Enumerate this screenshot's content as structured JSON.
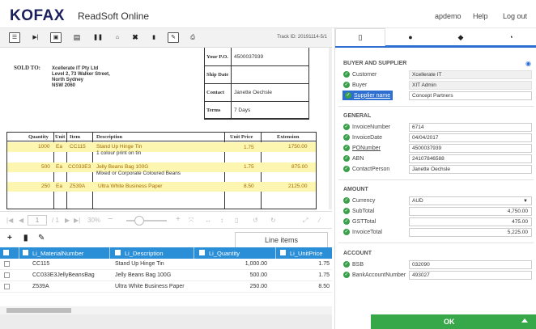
{
  "header": {
    "logo": "KOFAX",
    "app_name": "ReadSoft Online",
    "user": "apdemo",
    "help": "Help",
    "logout": "Log out"
  },
  "toolbar": {
    "track_id": "Track ID: 20191114-5/1",
    "icons": [
      "list-icon",
      "play-icon",
      "image-icon",
      "save-icon",
      "pause-icon",
      "inbox-icon",
      "delete-x-icon",
      "trash-icon",
      "edit-icon",
      "print-icon"
    ]
  },
  "document": {
    "po_fields": [
      {
        "k": "Your P.O.",
        "v": "4500037939"
      },
      {
        "k": "Ship Date",
        "v": ""
      },
      {
        "k": "Contact",
        "v": "Janette Oechsle"
      },
      {
        "k": "Terms",
        "v": "7 Days"
      }
    ],
    "sold_to_label": "SOLD TO:",
    "address": [
      "Xcellerate IT Pty Ltd",
      "Level 2, 73 Walker Street,",
      "North Sydney",
      "NSW 2060"
    ],
    "columns": [
      "Quantity",
      "Unit",
      "Item",
      "Description",
      "Unit Price",
      "Extension"
    ],
    "rows": [
      {
        "qty": "1000",
        "unit": "Ea",
        "item": "CC115",
        "desc": "Stand Up Hinge Tin",
        "desc2": "1 colour print on tin",
        "price": "1.75",
        "ext": "1750.00"
      },
      {
        "qty": "500",
        "unit": "Ea",
        "item": "CC033E3",
        "desc": "Jelly Beans Bag 100G",
        "desc2": "Mixed or Corporate Coloured Beans",
        "price": "1.75",
        "ext": "875.00"
      },
      {
        "qty": "250",
        "unit": "Ea",
        "item": "Z539A",
        "desc": "Ultra White Business Paper",
        "desc2": "",
        "price": "8.50",
        "ext": "2125.00"
      }
    ]
  },
  "viewer": {
    "page_current": "1",
    "page_total": "/ 1",
    "zoom": "30%"
  },
  "line_items": {
    "title": "Line items",
    "columns": [
      "Li_MaterialNumber",
      "Li_Description",
      "Li_Quantity",
      "Li_UnitPrice"
    ],
    "rows": [
      {
        "mat": "CC115",
        "desc": "Stand Up Hinge Tin",
        "qty": "1,000.00",
        "price": "1.75"
      },
      {
        "mat": "CC033E3JellyBeansBag",
        "desc": "Jelly Beans Bag 100G",
        "qty": "500.00",
        "price": "1.75"
      },
      {
        "mat": "Z539A",
        "desc": "Ultra White Business Paper",
        "qty": "250.00",
        "price": "8.50"
      }
    ]
  },
  "right_pane": {
    "tabs": [
      "file-icon",
      "info-icon",
      "comment-icon",
      "clock-icon"
    ],
    "sections": {
      "buyer_supplier": {
        "title": "BUYER AND SUPPLIER",
        "fields": [
          {
            "label": "Customer",
            "value": "Xcellerate IT"
          },
          {
            "label": "Buyer",
            "value": "XIT Admin"
          },
          {
            "label": "Supplier name",
            "value": "Concept Partners"
          }
        ]
      },
      "general": {
        "title": "GENERAL",
        "fields": [
          {
            "label": "InvoiceNumber",
            "value": "6714"
          },
          {
            "label": "InvoiceDate",
            "value": "04/04/2017"
          },
          {
            "label": "PONumber",
            "value": "4500037939"
          },
          {
            "label": "ABN",
            "value": "24107846588"
          },
          {
            "label": "ContactPerson",
            "value": "Janette Oechsle"
          }
        ]
      },
      "amount": {
        "title": "AMOUNT",
        "fields": [
          {
            "label": "Currency",
            "value": "AUD"
          },
          {
            "label": "SubTotal",
            "value": "4,750.00"
          },
          {
            "label": "GSTTotal",
            "value": "475.00"
          },
          {
            "label": "InvoiceTotal",
            "value": "5,225.00"
          }
        ]
      },
      "account": {
        "title": "ACCOUNT",
        "fields": [
          {
            "label": "BSB",
            "value": "032090"
          },
          {
            "label": "BankAccountNumber",
            "value": "493027"
          }
        ]
      }
    },
    "ok_label": "OK"
  },
  "colors": {
    "brand": "#1b1f5c",
    "accent": "#2c6fd1",
    "grid_header": "#2b8fd8",
    "ok": "#37a84a",
    "highlight": "#fdf6b0"
  }
}
